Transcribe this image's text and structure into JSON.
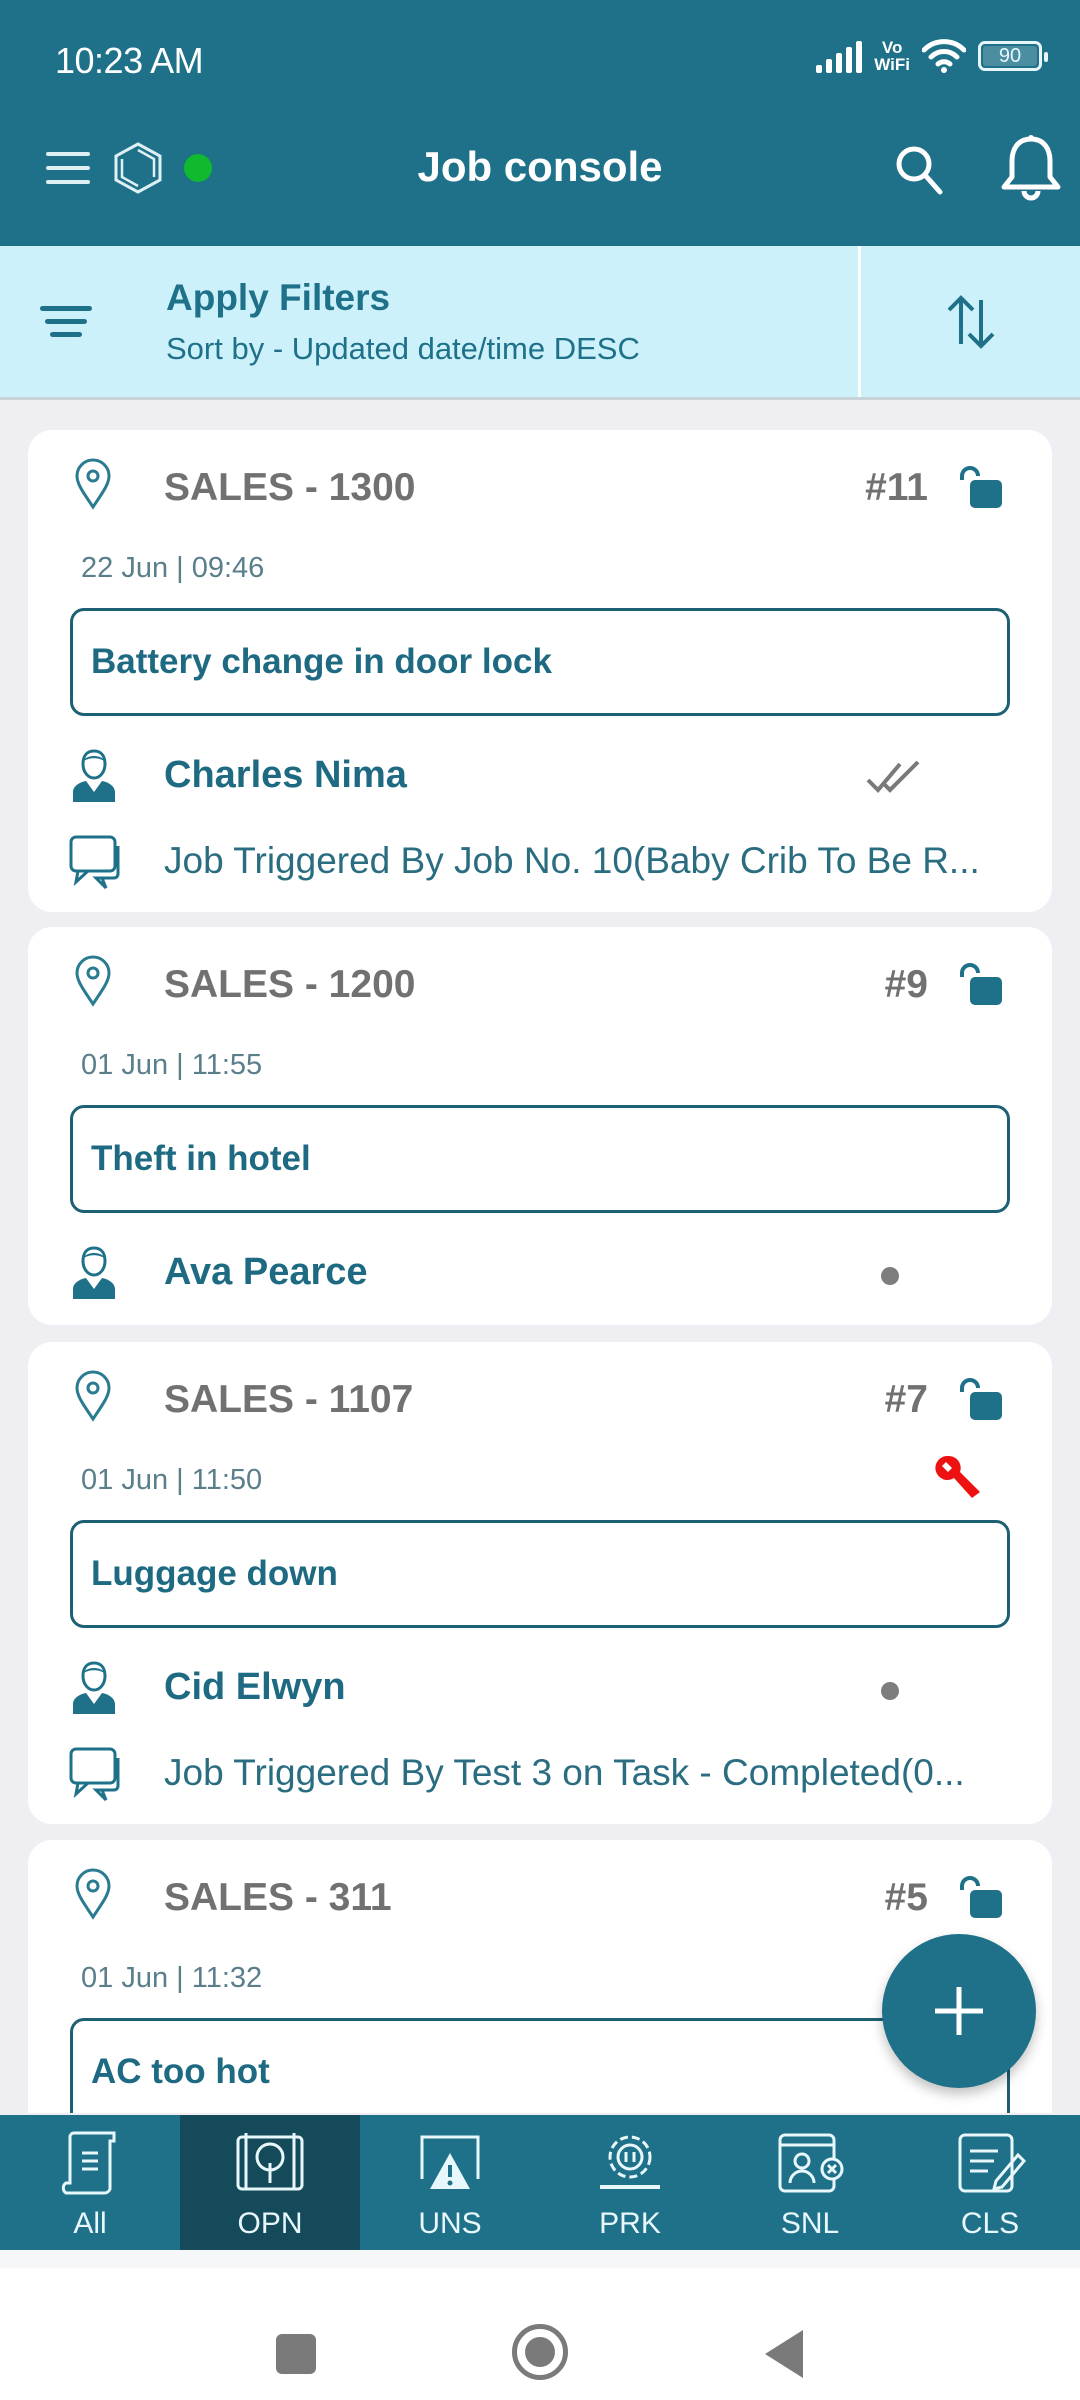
{
  "status_bar": {
    "time": "10:23 AM",
    "network_label_top": "Vo",
    "network_label_bottom": "WiFi",
    "battery_level": "90",
    "icons": [
      "signal-icon",
      "vowifi-icon",
      "wifi-icon",
      "battery-icon"
    ]
  },
  "app_bar": {
    "title": "Job console",
    "online_status_color": "#10b92e",
    "icons": [
      "menu-icon",
      "app-logo-icon",
      "search-icon",
      "bell-icon"
    ]
  },
  "filter_bar": {
    "title": "Apply Filters",
    "subtitle": "Sort by - Updated date/time DESC",
    "icons": [
      "filter-icon",
      "sort-icon"
    ]
  },
  "jobs": [
    {
      "location": "SALES - 1300",
      "job_number": "#11",
      "lock_state": "unlocked",
      "datetime": "22 Jun | 09:46",
      "title": "Battery change in door lock",
      "assignee": "Charles Nima",
      "status_indicator": "double-check",
      "comment": "Job Triggered By Job No. 10(Baby Crib To Be R..."
    },
    {
      "location": "SALES - 1200",
      "job_number": "#9",
      "lock_state": "unlocked",
      "datetime": "01 Jun | 11:55",
      "title": "Theft in hotel",
      "assignee": "Ava Pearce",
      "status_indicator": "dot"
    },
    {
      "location": "SALES - 1107",
      "job_number": "#7",
      "lock_state": "unlocked",
      "datetime": "01 Jun | 11:50",
      "maintenance_flag": true,
      "title": "Luggage down",
      "assignee": "Cid Elwyn",
      "status_indicator": "dot",
      "comment": "Job Triggered By Test 3 on Task - Completed(0..."
    },
    {
      "location": "SALES - 311",
      "job_number": "#5",
      "lock_state": "unlocked",
      "datetime": "01 Jun | 11:32",
      "title": "AC too hot"
    }
  ],
  "fab": {
    "icon": "plus-icon"
  },
  "tabs": [
    {
      "label": "All",
      "icon": "scroll-list-icon",
      "active": false
    },
    {
      "label": "OPN",
      "icon": "blueprint-icon",
      "active": true
    },
    {
      "label": "UNS",
      "icon": "warning-icon",
      "active": false
    },
    {
      "label": "PRK",
      "icon": "gear-pause-icon",
      "active": false
    },
    {
      "label": "SNL",
      "icon": "user-cancel-icon",
      "active": false
    },
    {
      "label": "CLS",
      "icon": "checklist-edit-icon",
      "active": false
    }
  ],
  "colors": {
    "primary": "#1e7189",
    "primary_dark": "#144a5a",
    "filter_bg": "#cdf1fa",
    "wrench": "#ee1111",
    "text_grey": "#717171"
  }
}
